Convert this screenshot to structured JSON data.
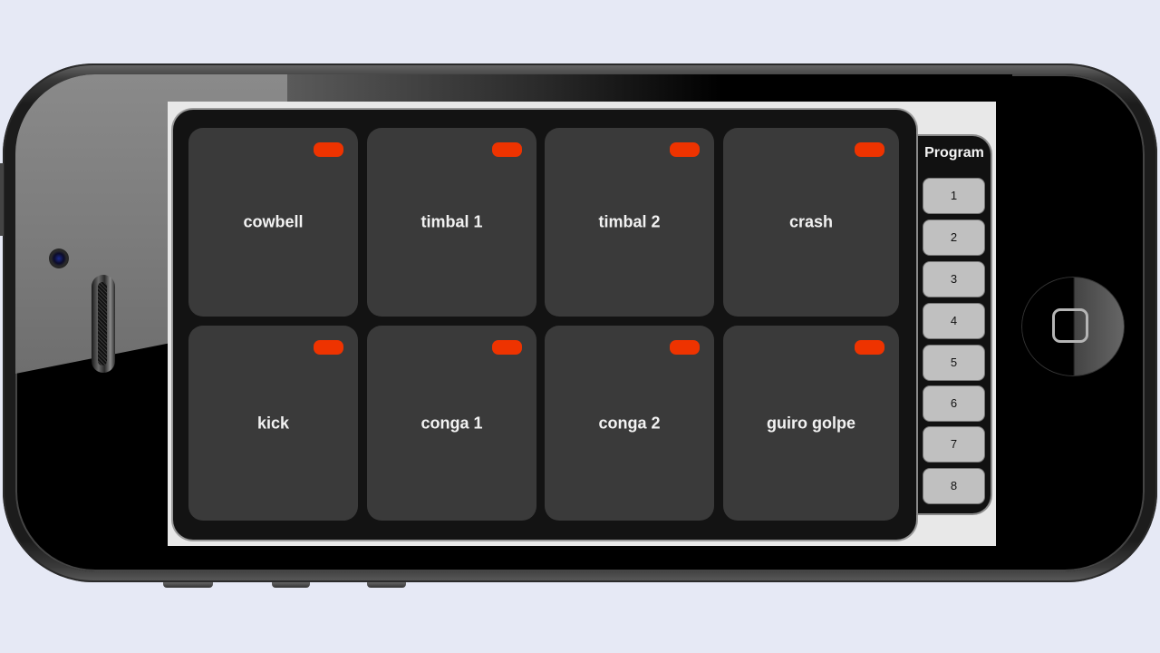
{
  "app": {
    "pads": [
      {
        "label": "cowbell"
      },
      {
        "label": "timbal 1"
      },
      {
        "label": "timbal 2"
      },
      {
        "label": "crash"
      },
      {
        "label": "kick"
      },
      {
        "label": "conga 1"
      },
      {
        "label": "conga 2"
      },
      {
        "label": "guiro golpe"
      }
    ],
    "program": {
      "title": "Program",
      "buttons": [
        "1",
        "2",
        "3",
        "4",
        "5",
        "6",
        "7",
        "8"
      ]
    }
  },
  "colors": {
    "pad_led": "#ee3300",
    "pad_bg": "#3a3a3a",
    "panel_bg": "#131313",
    "program_button_bg": "#c0c0c0",
    "background": "#e6e9f5"
  }
}
